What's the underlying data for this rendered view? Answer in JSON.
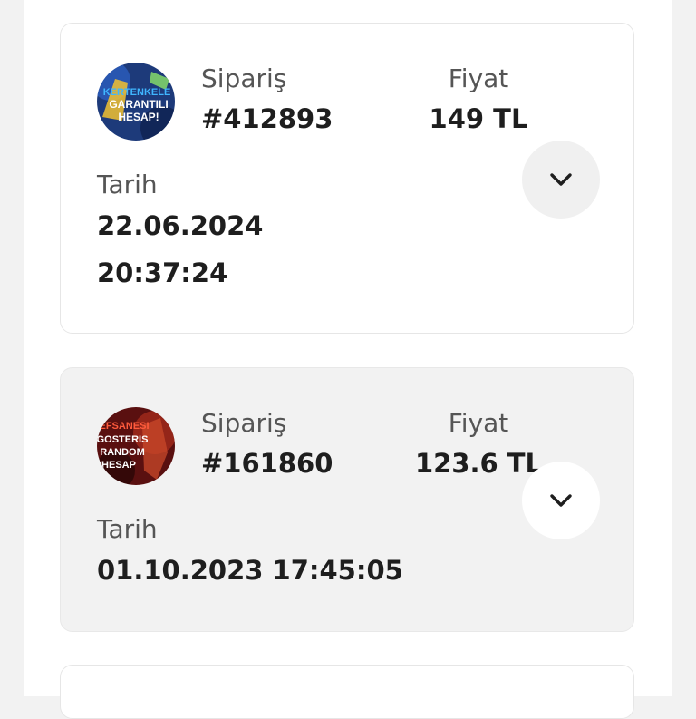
{
  "orders": [
    {
      "order_label": "Sipariş",
      "order_number": "#412893",
      "price_label": "Fiyat",
      "price": "149 TL",
      "date_label": "Tarih",
      "date_line1": "22.06.2024",
      "date_line2": "20:37:24",
      "thumb_text": [
        "KERTENKELE",
        "GARANTILI",
        "HESAP!"
      ],
      "thumb_colors": {
        "bg": "#1d3a7a",
        "text": "#ffffff",
        "accent": "#f2c230"
      }
    },
    {
      "order_label": "Sipariş",
      "order_number": "#161860",
      "price_label": "Fiyat",
      "price": "123.6 TL",
      "date_label": "Tarih",
      "date_line1": "01.10.2023 17:45:05",
      "thumb_text": [
        "EFSANESI",
        "GOSTERIS",
        "RANDOM",
        "HESAP"
      ],
      "thumb_colors": {
        "bg": "#6e1414",
        "text": "#ffffff",
        "accent": "#e03b2a"
      }
    }
  ],
  "icons": {
    "expand": "chevron-down-icon"
  }
}
